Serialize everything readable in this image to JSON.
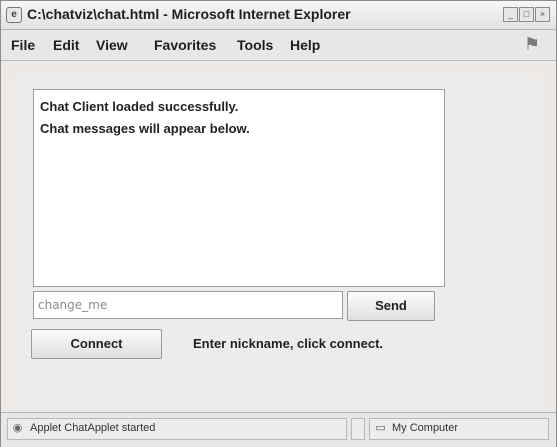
{
  "window": {
    "title": "C:\\chatviz\\chat.html - Microsoft Internet Explorer"
  },
  "menubar": {
    "items": [
      "File",
      "Edit",
      "View",
      "Favorites",
      "Tools",
      "Help"
    ]
  },
  "chat": {
    "messages": [
      "Chat Client loaded successfully.",
      "Chat messages will appear below."
    ]
  },
  "nickname_input": {
    "value": "change_me"
  },
  "buttons": {
    "send_label": "Send",
    "connect_label": "Connect"
  },
  "hint_text": "Enter nickname, click connect.",
  "statusbar": {
    "left_text": "Applet ChatApplet started",
    "zone_text": "My Computer"
  },
  "icons": {
    "title": "ie-page-icon",
    "ie_logo": "windows-logo-icon",
    "status_applet": "applet-icon",
    "status_zone": "computer-icon"
  }
}
